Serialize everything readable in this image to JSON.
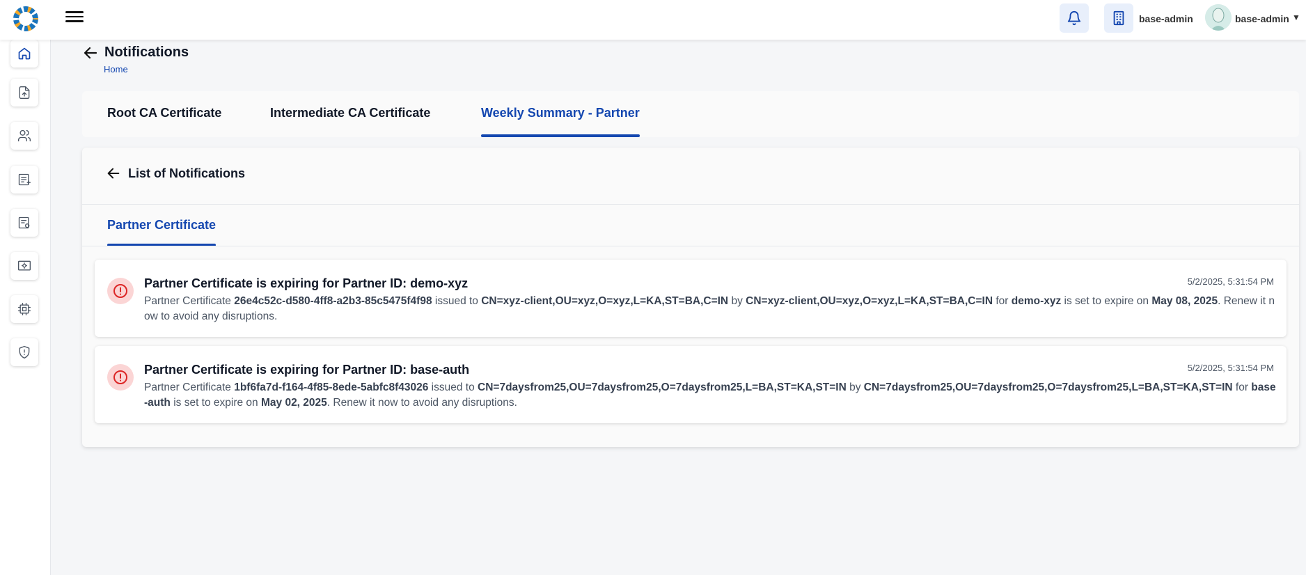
{
  "header": {
    "org_name": "base-admin",
    "user_name": "base-admin",
    "user_caret": "▼"
  },
  "page": {
    "title": "Notifications",
    "breadcrumb": "Home"
  },
  "tabs": [
    {
      "label": "Root CA Certificate",
      "active": false
    },
    {
      "label": "Intermediate CA Certificate",
      "active": false
    },
    {
      "label": "Weekly Summary - Partner",
      "active": true
    }
  ],
  "list": {
    "title": "List of Notifications",
    "subtab": "Partner Certificate"
  },
  "notifications": [
    {
      "title": "Partner Certificate is expiring for Partner ID: demo-xyz",
      "time": "5/2/2025, 5:31:54 PM",
      "prefix": "Partner Certificate ",
      "cert_id": "26e4c52c-d580-4ff8-a2b3-85c5475f4f98",
      "issued_to_label": " issued to ",
      "issued_to": "CN=xyz-client,OU=xyz,O=xyz,L=KA,ST=BA,C=IN",
      "by_label": " by ",
      "issued_by": "CN=xyz-client,OU=xyz,O=xyz,L=KA,ST=BA,C=IN",
      "for_label": " for ",
      "partner_id": "demo-xyz",
      "expire_label": " is set to expire on ",
      "expiry_date": "May 08, 2025",
      "suffix": ". Renew it now to avoid any disruptions."
    },
    {
      "title": "Partner Certificate is expiring for Partner ID: base-auth",
      "time": "5/2/2025, 5:31:54 PM",
      "prefix": "Partner Certificate ",
      "cert_id": "1bf6fa7d-f164-4f85-8ede-5abfc8f43026",
      "issued_to_label": " issued to ",
      "issued_to": "CN=7daysfrom25,OU=7daysfrom25,O=7daysfrom25,L=BA,ST=KA,ST=IN",
      "by_label": " by ",
      "issued_by": "CN=7daysfrom25,OU=7daysfrom25,O=7daysfrom25,L=BA,ST=KA,ST=IN",
      "for_label": " for ",
      "partner_id": "base-auth",
      "expire_label": " is set to expire on ",
      "expiry_date": "May 02, 2025",
      "suffix": ". Renew it now to avoid any disruptions."
    }
  ],
  "icons": {
    "logo": "logo-icon",
    "menu": "menu-icon",
    "bell": "bell-icon",
    "org": "building-icon",
    "alert": "alert-circle-icon",
    "alert_color": "#dc2626",
    "accent": "#1447b0"
  }
}
